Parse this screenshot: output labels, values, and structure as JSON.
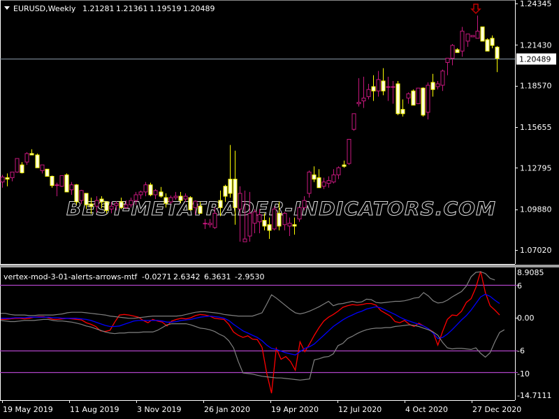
{
  "window": {
    "symbol_title": "EURUSD,Weekly",
    "ohlc_readout": [
      "1.21281",
      "1.21361",
      "1.19519",
      "1.20489"
    ],
    "watermark": "BEST-METATRADER-INDICATORS.COM",
    "colors": {
      "background": "#000000",
      "bull_candle": "#c8177e",
      "bear_candle": "#ffff00",
      "bear_body_fill": "#ffffe0",
      "price_line": "#8a9aa8",
      "level_line": "#b044c8",
      "red_line": "#ff0000",
      "blue_line": "#0000ff",
      "band_line": "#808080",
      "arrow": "#c00000"
    }
  },
  "chart_data": [
    {
      "type": "candlestick",
      "title": "EURUSD,Weekly",
      "ylim": [
        1.0675,
        1.246
      ],
      "y_ticks": [
        "1.24345",
        "1.21430",
        "1.18570",
        "1.15655",
        "1.12795",
        "1.09880",
        "1.07020"
      ],
      "current_price_label": "1.20489",
      "current_price": 1.20489,
      "x_ticks": [
        "19 May 2019",
        "11 Aug 2019",
        "3 Nov 2019",
        "26 Jan 2020",
        "19 Apr 2020",
        "12 Jul 2020",
        "4 Oct 2020",
        "27 Dec 2020"
      ],
      "candles": [
        [
          1.118,
          1.123,
          1.114,
          1.1215
        ],
        [
          1.121,
          1.124,
          1.115,
          1.12
        ],
        [
          1.121,
          1.1245,
          1.1185,
          1.125
        ],
        [
          1.125,
          1.131,
          1.1245,
          1.1345
        ],
        [
          1.13,
          1.132,
          1.124,
          1.1245
        ],
        [
          1.132,
          1.139,
          1.13,
          1.138
        ],
        [
          1.138,
          1.141,
          1.138,
          1.137
        ],
        [
          1.137,
          1.138,
          1.128,
          1.128
        ],
        [
          1.126,
          1.13,
          1.124,
          1.13
        ],
        [
          1.127,
          1.127,
          1.122,
          1.122
        ],
        [
          1.122,
          1.1225,
          1.114,
          1.1155
        ],
        [
          1.116,
          1.1175,
          1.108,
          1.116
        ],
        [
          1.115,
          1.1225,
          1.1145,
          1.1225
        ],
        [
          1.123,
          1.124,
          1.111,
          1.111
        ],
        [
          1.1125,
          1.118,
          1.109,
          1.116
        ],
        [
          1.116,
          1.1165,
          1.102,
          1.104
        ],
        [
          1.105,
          1.1125,
          1.1025,
          1.112
        ],
        [
          1.11,
          1.11,
          1.099,
          1.102
        ],
        [
          1.1025,
          1.107,
          1.0955,
          1.101
        ],
        [
          1.101,
          1.108,
          1.0965,
          1.105
        ],
        [
          1.106,
          1.108,
          1.0995,
          1.104
        ],
        [
          1.104,
          1.104,
          1.096,
          1.098
        ],
        [
          1.099,
          1.104,
          1.096,
          1.101
        ],
        [
          1.1015,
          1.1045,
          1.098,
          1.103
        ],
        [
          1.104,
          1.107,
          1.099,
          1.1
        ],
        [
          1.1,
          1.105,
          1.099,
          1.102
        ],
        [
          1.102,
          1.107,
          1.1,
          1.105
        ],
        [
          1.105,
          1.111,
          1.102,
          1.109
        ],
        [
          1.109,
          1.112,
          1.106,
          1.111
        ],
        [
          1.111,
          1.118,
          1.108,
          1.116
        ],
        [
          1.116,
          1.1175,
          1.108,
          1.109
        ],
        [
          1.109,
          1.113,
          1.106,
          1.112
        ],
        [
          1.111,
          1.1145,
          1.107,
          1.108
        ],
        [
          1.107,
          1.11,
          1.1,
          1.103
        ],
        [
          1.104,
          1.1085,
          1.1025,
          1.107
        ],
        [
          1.107,
          1.111,
          1.1055,
          1.108
        ],
        [
          1.108,
          1.111,
          1.103,
          1.105
        ],
        [
          1.106,
          1.11,
          1.104,
          1.108
        ],
        [
          1.107,
          1.108,
          1.098,
          1.0985
        ],
        [
          1.1,
          1.105,
          1.095,
          1.1045
        ],
        [
          1.101,
          1.104,
          1.096,
          1.096
        ],
        [
          1.089,
          1.092,
          1.085,
          1.089
        ],
        [
          1.088,
          1.092,
          1.086,
          1.089
        ],
        [
          1.086,
          1.1,
          1.085,
          1.096
        ],
        [
          1.105,
          1.112,
          1.094,
          1.1
        ],
        [
          1.115,
          1.116,
          1.104,
          1.108
        ],
        [
          1.12,
          1.144,
          1.107,
          1.11
        ],
        [
          1.12,
          1.14,
          1.088,
          1.1
        ],
        [
          1.099,
          1.115,
          1.076,
          1.11
        ],
        [
          1.076,
          1.112,
          1.076,
          1.078
        ],
        [
          1.08,
          1.111,
          1.076,
          1.096
        ],
        [
          1.089,
          1.099,
          1.082,
          1.097
        ],
        [
          1.09,
          1.099,
          1.082,
          1.095
        ],
        [
          1.091,
          1.096,
          1.084,
          1.087
        ],
        [
          1.088,
          1.093,
          1.078,
          1.084
        ],
        [
          1.085,
          1.101,
          1.084,
          1.099
        ],
        [
          1.096,
          1.104,
          1.084,
          1.087
        ],
        [
          1.088,
          1.097,
          1.084,
          1.096
        ],
        [
          1.087,
          1.093,
          1.08,
          1.089
        ],
        [
          1.088,
          1.093,
          1.081,
          1.087
        ],
        [
          1.092,
          1.1,
          1.09,
          1.1
        ],
        [
          1.1,
          1.108,
          1.098,
          1.105
        ],
        [
          1.11,
          1.126,
          1.107,
          1.125
        ],
        [
          1.123,
          1.129,
          1.118,
          1.12
        ],
        [
          1.121,
          1.127,
          1.115,
          1.114
        ],
        [
          1.115,
          1.121,
          1.113,
          1.118
        ],
        [
          1.117,
          1.122,
          1.114,
          1.119
        ],
        [
          1.118,
          1.127,
          1.117,
          1.123
        ],
        [
          1.123,
          1.129,
          1.12,
          1.128
        ],
        [
          1.13,
          1.133,
          1.128,
          1.129
        ],
        [
          1.131,
          1.148,
          1.13,
          1.148
        ],
        [
          1.155,
          1.165,
          1.154,
          1.166
        ],
        [
          1.173,
          1.191,
          1.171,
          1.174
        ],
        [
          1.175,
          1.192,
          1.17,
          1.177
        ],
        [
          1.178,
          1.187,
          1.176,
          1.183
        ],
        [
          1.185,
          1.193,
          1.175,
          1.182
        ],
        [
          1.182,
          1.196,
          1.178,
          1.19
        ],
        [
          1.189,
          1.198,
          1.179,
          1.182
        ],
        [
          1.185,
          1.192,
          1.175,
          1.185
        ],
        [
          1.185,
          1.189,
          1.173,
          1.185
        ],
        [
          1.187,
          1.189,
          1.165,
          1.166
        ],
        [
          1.169,
          1.176,
          1.164,
          1.166
        ],
        [
          1.177,
          1.181,
          1.173,
          1.18
        ],
        [
          1.182,
          1.183,
          1.172,
          1.172
        ],
        [
          1.173,
          1.184,
          1.173,
          1.184
        ],
        [
          1.184,
          1.1845,
          1.164,
          1.165
        ],
        [
          1.167,
          1.188,
          1.162,
          1.186
        ],
        [
          1.188,
          1.194,
          1.178,
          1.183
        ],
        [
          1.185,
          1.189,
          1.183,
          1.187
        ],
        [
          1.186,
          1.197,
          1.182,
          1.196
        ],
        [
          1.202,
          1.2,
          1.193,
          1.205
        ],
        [
          1.205,
          1.215,
          1.2,
          1.214
        ],
        [
          1.211,
          1.212,
          1.21,
          1.209
        ],
        [
          1.21,
          1.227,
          1.206,
          1.224
        ],
        [
          1.217,
          1.217,
          1.213,
          1.222
        ],
        [
          1.22,
          1.22,
          1.223,
          1.221
        ],
        [
          1.219,
          1.235,
          1.22,
          1.224
        ],
        [
          1.227,
          1.227,
          1.217,
          1.217
        ],
        [
          1.218,
          1.219,
          1.21,
          1.21
        ],
        [
          1.219,
          1.221,
          1.212,
          1.214
        ],
        [
          1.2128,
          1.2136,
          1.1952,
          1.2049
        ]
      ]
    },
    {
      "type": "line",
      "title": "vertex-mod-3-01-alerts-arrows-mtf",
      "readout": [
        "-0.0271",
        "2.6342",
        "6.3631",
        "-2.9530"
      ],
      "ylim": [
        -14.7111,
        8.9085
      ],
      "y_ticks": [
        "8.9085",
        "6",
        "0.00",
        "-6",
        "-10",
        "-14.7111"
      ],
      "levels": [
        6,
        -6,
        -10
      ],
      "series": [
        {
          "name": "vertex",
          "color": "red",
          "values": [
            -0.3,
            -0.3,
            -0.2,
            -0.1,
            -0.1,
            -0.2,
            -0.1,
            0.1,
            0.2,
            0.2,
            0.0,
            -0.3,
            -0.3,
            -0.2,
            -0.1,
            -0.2,
            -0.3,
            -0.4,
            -0.9,
            -1.2,
            -1.6,
            -2.4,
            -2.5,
            -2.3,
            -0.8,
            0.5,
            0.6,
            0.5,
            0.3,
            0.1,
            -0.5,
            -0.9,
            -0.3,
            -0.6,
            -0.8,
            -1.5,
            -0.6,
            -0.3,
            -0.1,
            -0.2,
            0.0,
            0.4,
            0.6,
            0.5,
            0.3,
            -0.1,
            -0.2,
            -0.3,
            -1.2,
            -2.6,
            -3.2,
            -3.6,
            -3.3,
            -3.9,
            -4.0,
            -5.4,
            -10.2,
            -13.8,
            -5.6,
            -7.6,
            -7.1,
            -8.0,
            -9.6,
            -4.4,
            -6.2,
            -4.8,
            -3.2,
            -1.8,
            -0.6,
            0.1,
            0.6,
            1.2,
            1.9,
            2.2,
            2.4,
            2.3,
            2.4,
            2.6,
            2.6,
            2.3,
            1.3,
            0.8,
            0.3,
            -0.7,
            -0.9,
            -0.5,
            -1.2,
            -1.6,
            -1.0,
            -1.5,
            -2.0,
            -2.6,
            -5.0,
            -2.5,
            -0.3,
            0.5,
            0.4,
            1.2,
            2.8,
            3.5,
            5.5,
            8.5,
            4.6,
            2.2,
            1.4,
            0.5
          ]
        },
        {
          "name": "signal",
          "color": "blue",
          "values": [
            -0.1,
            -0.1,
            -0.1,
            0.0,
            0.0,
            0.0,
            0.1,
            0.1,
            0.1,
            0.1,
            0.1,
            0.0,
            0.0,
            -0.1,
            -0.1,
            -0.1,
            -0.1,
            -0.2,
            -0.3,
            -0.5,
            -0.8,
            -1.1,
            -1.4,
            -1.6,
            -1.6,
            -1.5,
            -1.2,
            -0.9,
            -0.6,
            -0.5,
            -0.5,
            -0.5,
            -0.5,
            -0.5,
            -0.6,
            -0.8,
            -0.8,
            -0.7,
            -0.5,
            -0.4,
            -0.3,
            -0.1,
            0.1,
            0.2,
            0.3,
            0.2,
            0.1,
            -0.1,
            -0.5,
            -1.2,
            -1.8,
            -2.4,
            -2.8,
            -3.2,
            -3.6,
            -4.2,
            -5.0,
            -5.6,
            -5.8,
            -6.1,
            -6.4,
            -6.6,
            -6.8,
            -6.2,
            -5.6,
            -5.3,
            -4.8,
            -4.0,
            -3.2,
            -2.4,
            -1.6,
            -1.0,
            -0.4,
            0.1,
            0.5,
            0.9,
            1.2,
            1.6,
            1.8,
            2.0,
            1.8,
            1.4,
            1.0,
            0.6,
            0.1,
            -0.3,
            -0.6,
            -0.9,
            -1.2,
            -1.5,
            -2.0,
            -2.8,
            -3.8,
            -3.6,
            -3.0,
            -2.2,
            -1.3,
            -0.4,
            0.4,
            1.4,
            2.6,
            3.8,
            4.3,
            3.9,
            3.2,
            2.6
          ]
        },
        {
          "name": "upper-band",
          "color": "gray",
          "values": [
            0.8,
            0.8,
            0.6,
            0.5,
            0.5,
            0.5,
            0.4,
            0.4,
            0.5,
            0.5,
            0.5,
            0.5,
            0.6,
            0.7,
            0.9,
            1.0,
            1.0,
            1.0,
            0.9,
            0.8,
            0.7,
            0.6,
            0.5,
            0.3,
            0.2,
            0.1,
            0.0,
            -0.1,
            -0.1,
            0.0,
            0.1,
            0.2,
            0.3,
            0.3,
            0.3,
            0.3,
            0.3,
            0.3,
            0.4,
            0.6,
            0.8,
            1.0,
            1.1,
            1.1,
            1.0,
            0.9,
            0.8,
            0.6,
            0.5,
            0.4,
            0.3,
            0.3,
            0.3,
            0.3,
            0.6,
            0.9,
            2.5,
            4.2,
            3.6,
            2.9,
            2.2,
            1.5,
            0.9,
            0.7,
            0.9,
            1.2,
            1.6,
            2.0,
            2.5,
            3.0,
            2.2,
            2.5,
            2.6,
            2.8,
            3.0,
            2.8,
            2.9,
            3.4,
            3.3,
            2.8,
            2.7,
            2.8,
            2.9,
            3.0,
            3.0,
            3.1,
            3.3,
            3.6,
            3.7,
            4.6,
            4.0,
            3.1,
            2.7,
            2.8,
            3.2,
            3.8,
            4.3,
            4.8,
            5.8,
            7.5,
            8.3,
            8.4,
            8.1,
            7.2,
            6.9
          ]
        },
        {
          "name": "lower-band",
          "color": "gray",
          "values": [
            -0.5,
            -0.6,
            -0.7,
            -0.7,
            -0.6,
            -0.5,
            -0.5,
            -0.5,
            -0.4,
            -0.3,
            -0.3,
            -0.5,
            -0.6,
            -0.6,
            -0.7,
            -0.8,
            -1.0,
            -1.2,
            -1.5,
            -1.7,
            -2.0,
            -2.3,
            -2.6,
            -2.8,
            -2.9,
            -2.8,
            -2.8,
            -2.7,
            -2.7,
            -2.7,
            -2.6,
            -2.6,
            -2.6,
            -2.3,
            -1.8,
            -1.3,
            -1.1,
            -1.1,
            -1.1,
            -1.1,
            -1.3,
            -1.6,
            -1.9,
            -2.0,
            -2.2,
            -2.5,
            -3.0,
            -3.4,
            -4.2,
            -5.5,
            -8.0,
            -10.1,
            -10.2,
            -10.3,
            -10.5,
            -10.7,
            -10.8,
            -10.9,
            -11.0,
            -11.0,
            -11.1,
            -11.2,
            -11.3,
            -11.4,
            -11.3,
            -11.2,
            -7.7,
            -7.5,
            -7.2,
            -7.1,
            -6.6,
            -5.1,
            -4.7,
            -3.8,
            -3.4,
            -2.9,
            -2.5,
            -2.2,
            -2.0,
            -1.9,
            -1.9,
            -1.8,
            -1.8,
            -1.6,
            -1.5,
            -1.4,
            -1.3,
            -1.4,
            -1.6,
            -1.9,
            -2.2,
            -2.6,
            -3.2,
            -4.5,
            -5.5,
            -5.7,
            -5.6,
            -5.6,
            -5.7,
            -5.8,
            -5.5,
            -6.5,
            -7.2,
            -6.4,
            -4.4,
            -2.7,
            -2.2
          ]
        }
      ]
    }
  ]
}
